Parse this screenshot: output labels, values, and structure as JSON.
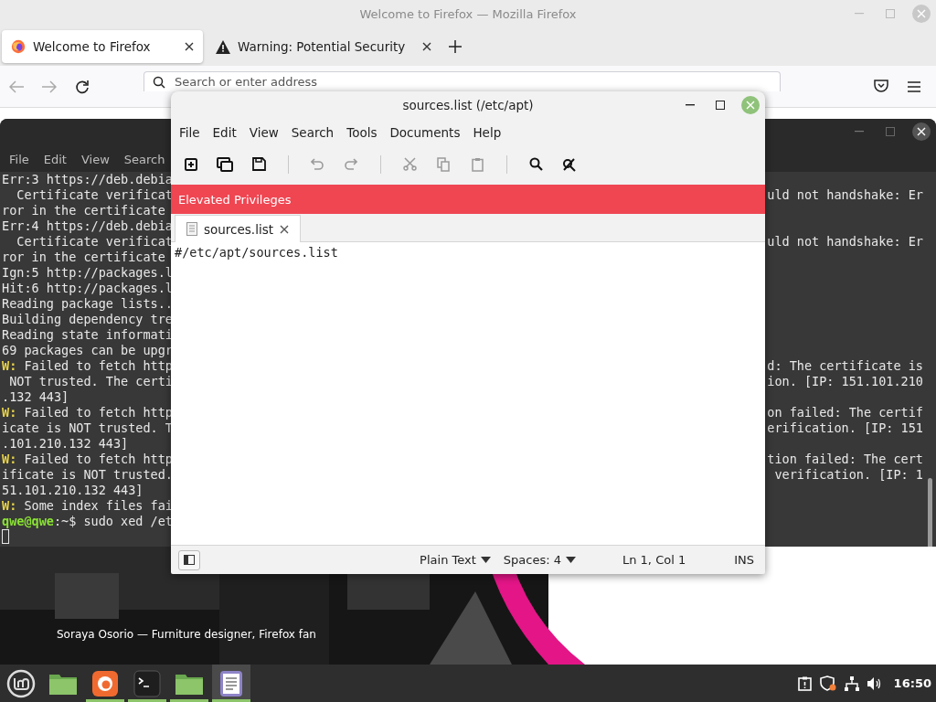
{
  "firefox": {
    "title": "Welcome to Firefox — Mozilla Firefox",
    "tabs": [
      {
        "label": "Welcome to Firefox",
        "selected": true,
        "kind": "firefox"
      },
      {
        "label": "Warning: Potential Security",
        "selected": false,
        "kind": "warning"
      }
    ],
    "address": {
      "placeholder": "Search or enter address"
    },
    "caption": "Soraya Osorio — Furniture designer, Firefox fan"
  },
  "terminal": {
    "menu": [
      "File",
      "Edit",
      "View",
      "Search"
    ],
    "lines": [
      {
        "kind": "plain",
        "text": "Err:3 https://deb.debia"
      },
      {
        "kind": "plain",
        "text": "  Certificate verificat",
        "right": "uld not handshake: Er"
      },
      {
        "kind": "plain",
        "text": "ror in the certificate"
      },
      {
        "kind": "plain",
        "text": "Err:4 https://deb.debia"
      },
      {
        "kind": "plain",
        "text": "  Certificate verificat",
        "right": "uld not handshake: Er"
      },
      {
        "kind": "plain",
        "text": "ror in the certificate"
      },
      {
        "kind": "plain",
        "text": "Ign:5 http://packages.l"
      },
      {
        "kind": "plain",
        "text": "Hit:6 http://packages.l"
      },
      {
        "kind": "plain",
        "text": "Reading package lists.."
      },
      {
        "kind": "plain",
        "text": "Building dependency tre"
      },
      {
        "kind": "plain",
        "text": "Reading state informati"
      },
      {
        "kind": "plain",
        "text": "69 packages can be upgr"
      },
      {
        "kind": "warning",
        "lead": "W:",
        "text": " Failed to fetch http",
        "right": "d: The certificate is"
      },
      {
        "kind": "plain",
        "text": " NOT trusted. The certi",
        "right": "ion. [IP: 151.101.210"
      },
      {
        "kind": "plain",
        "text": ".132 443]"
      },
      {
        "kind": "warning",
        "lead": "W:",
        "text": " Failed to fetch http",
        "right": "on failed: The certif"
      },
      {
        "kind": "plain",
        "text": "icate is NOT trusted. T",
        "right": "erification. [IP: 151"
      },
      {
        "kind": "plain",
        "text": ".101.210.132 443]"
      },
      {
        "kind": "warning",
        "lead": "W:",
        "text": " Failed to fetch http",
        "right": "tion failed: The cert"
      },
      {
        "kind": "plain",
        "text": "ificate is NOT trusted.",
        "right": " verification. [IP: 1"
      },
      {
        "kind": "plain",
        "text": "51.101.210.132 443]"
      },
      {
        "kind": "warning",
        "lead": "W:",
        "text": " Some index files fai"
      },
      {
        "kind": "prompt",
        "lead": "qwe@qwe",
        "text": ":~$ sudo xed /et"
      }
    ]
  },
  "editor": {
    "title": "sources.list (/etc/apt)",
    "menu": [
      "File",
      "Edit",
      "View",
      "Search",
      "Tools",
      "Documents",
      "Help"
    ],
    "toolbar": [
      {
        "kind": "new",
        "disabled": false
      },
      {
        "kind": "open",
        "disabled": false
      },
      {
        "kind": "save",
        "disabled": false
      },
      {
        "kind": "separator"
      },
      {
        "kind": "undo",
        "disabled": true
      },
      {
        "kind": "redo",
        "disabled": true
      },
      {
        "kind": "separator"
      },
      {
        "kind": "cut",
        "disabled": true
      },
      {
        "kind": "copy",
        "disabled": true
      },
      {
        "kind": "paste",
        "disabled": true
      },
      {
        "kind": "separator"
      },
      {
        "kind": "search",
        "disabled": false
      },
      {
        "kind": "replace",
        "disabled": false
      }
    ],
    "banner": "Elevated Privileges",
    "tabs": [
      {
        "label": "sources.list",
        "selected": true
      }
    ],
    "content": "#/etc/apt/sources.list",
    "status": {
      "language": "Plain Text",
      "spaces": "Spaces: 4",
      "position": "Ln 1, Col 1",
      "mode": "INS"
    }
  },
  "taskbar": {
    "apps": [
      {
        "kind": "folder",
        "running": false,
        "selected": false
      },
      {
        "kind": "firefox",
        "running": true,
        "selected": false
      },
      {
        "kind": "terminal",
        "running": true,
        "selected": false
      },
      {
        "kind": "folder",
        "running": true,
        "selected": false
      },
      {
        "kind": "editor",
        "running": true,
        "selected": true
      }
    ],
    "clock": "16:50"
  }
}
